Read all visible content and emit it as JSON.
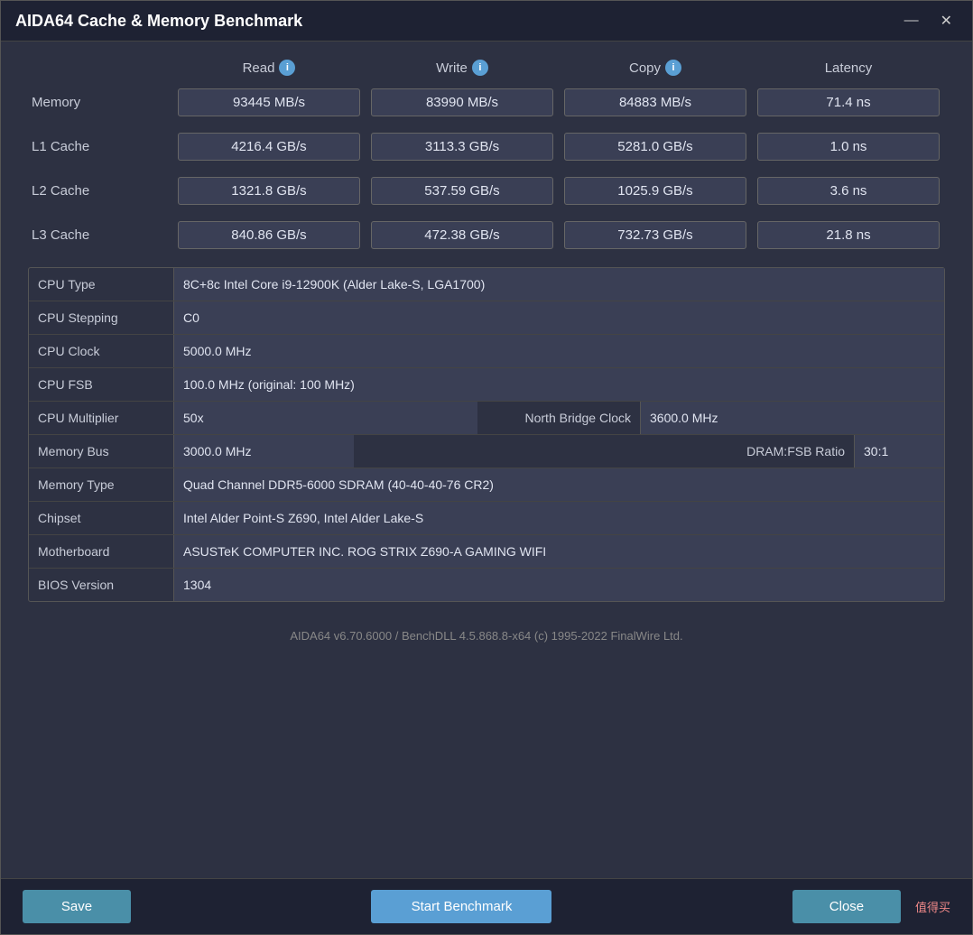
{
  "window": {
    "title": "AIDA64 Cache & Memory Benchmark"
  },
  "titlebar": {
    "minimize": "—",
    "close": "✕"
  },
  "bench": {
    "headers": {
      "empty": "",
      "read": "Read",
      "write": "Write",
      "copy": "Copy",
      "latency": "Latency"
    },
    "rows": [
      {
        "label": "Memory",
        "read": "93445 MB/s",
        "write": "83990 MB/s",
        "copy": "84883 MB/s",
        "latency": "71.4 ns"
      },
      {
        "label": "L1 Cache",
        "read": "4216.4 GB/s",
        "write": "3113.3 GB/s",
        "copy": "5281.0 GB/s",
        "latency": "1.0 ns"
      },
      {
        "label": "L2 Cache",
        "read": "1321.8 GB/s",
        "write": "537.59 GB/s",
        "copy": "1025.9 GB/s",
        "latency": "3.6 ns"
      },
      {
        "label": "L3 Cache",
        "read": "840.86 GB/s",
        "write": "472.38 GB/s",
        "copy": "732.73 GB/s",
        "latency": "21.8 ns"
      }
    ]
  },
  "info": {
    "cpu_type_label": "CPU Type",
    "cpu_type_value": "8C+8c Intel Core i9-12900K  (Alder Lake-S, LGA1700)",
    "cpu_stepping_label": "CPU Stepping",
    "cpu_stepping_value": "C0",
    "cpu_clock_label": "CPU Clock",
    "cpu_clock_value": "5000.0 MHz",
    "cpu_fsb_label": "CPU FSB",
    "cpu_fsb_value": "100.0 MHz  (original: 100 MHz)",
    "cpu_multiplier_label": "CPU Multiplier",
    "cpu_multiplier_value": "50x",
    "north_bridge_label": "North Bridge Clock",
    "north_bridge_value": "3600.0 MHz",
    "memory_bus_label": "Memory Bus",
    "memory_bus_value": "3000.0 MHz",
    "dram_fsb_label": "DRAM:FSB Ratio",
    "dram_fsb_value": "30:1",
    "memory_type_label": "Memory Type",
    "memory_type_value": "Quad Channel DDR5-6000 SDRAM  (40-40-40-76 CR2)",
    "chipset_label": "Chipset",
    "chipset_value": "Intel Alder Point-S Z690, Intel Alder Lake-S",
    "motherboard_label": "Motherboard",
    "motherboard_value": "ASUSTeK COMPUTER INC. ROG STRIX Z690-A GAMING WIFI",
    "bios_label": "BIOS Version",
    "bios_value": "1304"
  },
  "footer": {
    "text": "AIDA64 v6.70.6000 / BenchDLL 4.5.868.8-x64  (c) 1995-2022 FinalWire Ltd."
  },
  "buttons": {
    "save": "Save",
    "start_benchmark": "Start Benchmark",
    "close": "Close"
  },
  "watermark": "值得买"
}
